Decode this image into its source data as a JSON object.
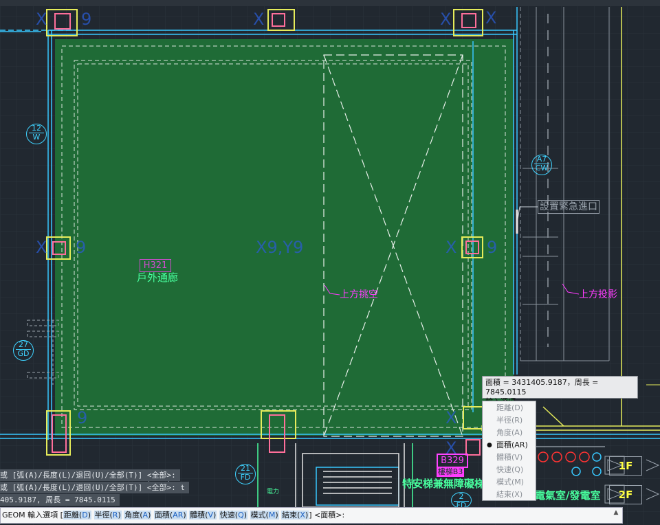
{
  "colors": {
    "background": "#212830",
    "fill": "#1f6b36",
    "wall": "#38c8ff",
    "dashed": "#e6e6e6",
    "column": "#ff6f9a",
    "annotation": "#ff3cff",
    "room_text": "#48ff9e"
  },
  "drawing": {
    "ghost_labels": [
      "X",
      "9",
      "X",
      "X",
      "X",
      "9",
      "X",
      "X9,Y9",
      "X",
      "9",
      "X",
      "9",
      "X",
      "X"
    ],
    "grid_bubbles": [
      {
        "top": "12",
        "bottom": "W"
      },
      {
        "top": "A7",
        "bottom": "CW"
      },
      {
        "top": "27",
        "bottom": "GD"
      },
      {
        "top": "21",
        "bottom": "FD"
      },
      {
        "top": "2",
        "bottom": "FD"
      },
      {
        "top": "",
        "bottom": "GD"
      }
    ],
    "room_code": "H321",
    "room_name": "戶外通廊",
    "void_above": "上方挑空",
    "projection_above": "上方投影",
    "emergency_entry": "設置緊急進口",
    "room_b329": "B329",
    "b329_sub": "樓梯B3",
    "elevator_label": "特安梯兼無障礙梯",
    "power_room": "電氣室/發電室",
    "floor_1": "1F",
    "floor_2": "2F",
    "small_power": "電力"
  },
  "tooltip": {
    "result": "面積 = 3431405.9187，周長 = 7845.0115",
    "prompt": "輸入選項"
  },
  "menu": {
    "items": [
      {
        "label": "距離(D)"
      },
      {
        "label": "半徑(R)"
      },
      {
        "label": "角度(A)"
      },
      {
        "label": "面積(AR)"
      },
      {
        "label": "體積(V)"
      },
      {
        "label": "快速(Q)"
      },
      {
        "label": "模式(M)"
      },
      {
        "label": "結束(X)"
      }
    ],
    "selected": "面積(AR)"
  },
  "command_history": [
    "或 [弧(A)/長度(L)/退回(U)/全部(T)] <全部>:",
    "或 [弧(A)/長度(L)/退回(U)/全部(T)] <全部>: t",
    "405.9187, 周長 = 7845.0115"
  ],
  "command_line": {
    "prefix": "GEOM 輸入選項 [",
    "options": [
      {
        "label": "距離(",
        "key": "D",
        "end": ")"
      },
      {
        "label": "半徑(",
        "key": "R",
        "end": ")"
      },
      {
        "label": "角度(",
        "key": "A",
        "end": ")"
      },
      {
        "label": "面積(",
        "key": "AR",
        "end": ")"
      },
      {
        "label": "體積(",
        "key": "V",
        "end": ")"
      },
      {
        "label": "快速(",
        "key": "Q",
        "end": ")"
      },
      {
        "label": "模式(",
        "key": "M",
        "end": ")"
      },
      {
        "label": "結束(",
        "key": "X",
        "end": ")"
      }
    ],
    "suffix": "] <面積>:"
  }
}
